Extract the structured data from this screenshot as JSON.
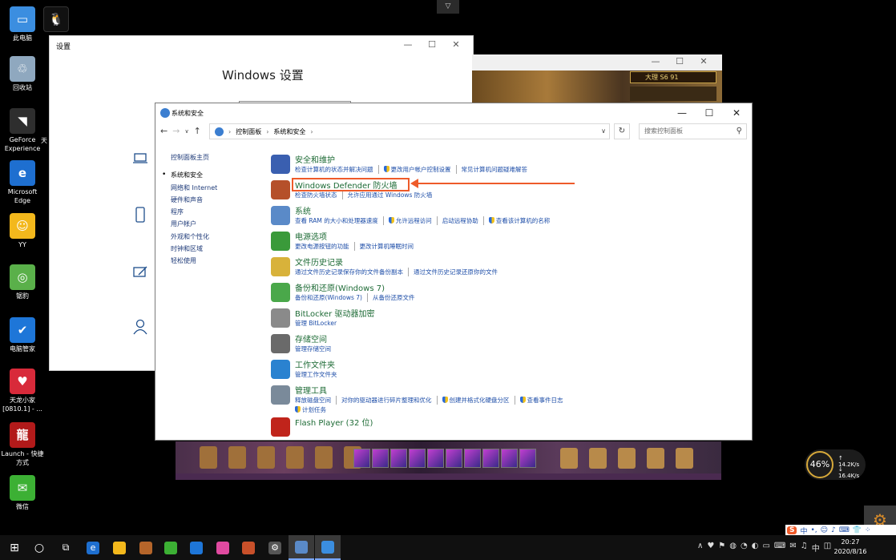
{
  "desktop": {
    "icons": [
      {
        "label": "此电脑",
        "color": "#3b8ee0",
        "glyph": "▭"
      },
      {
        "label": "回收站",
        "color": "#8fa8bf",
        "glyph": "♲"
      },
      {
        "label": "GeForce Experience",
        "color": "#2e2e2e",
        "glyph": "◥"
      },
      {
        "label": "Microsoft Edge",
        "color": "#1e6fd0",
        "glyph": "e"
      },
      {
        "label": "YY",
        "color": "#f3b81c",
        "glyph": "☺"
      },
      {
        "label": "锯豹",
        "color": "#5ab04a",
        "glyph": "◎"
      },
      {
        "label": "电脑管家",
        "color": "#1e76d8",
        "glyph": "✔"
      },
      {
        "label": "天龙小家 [0810.1] - ...",
        "color": "#d82a3a",
        "glyph": "♥"
      },
      {
        "label": "Launch - 快捷方式",
        "color": "#b21a1a",
        "glyph": "龍"
      },
      {
        "label": "微信",
        "color": "#3cb034",
        "glyph": "✉"
      }
    ],
    "partial_labels": [
      "天"
    ]
  },
  "settings_window": {
    "title": "设置",
    "heading": "Windows 设置",
    "controls": [
      "—",
      "☐",
      "✕"
    ]
  },
  "game_window": {
    "badge": "大理    S6  91",
    "controls": [
      "—",
      "☐",
      "✕"
    ]
  },
  "control_panel": {
    "title": "系统和安全",
    "controls": [
      "—",
      "☐",
      "✕"
    ],
    "nav": {
      "back": "←",
      "forward": "→",
      "dropdown": "∨",
      "up": "↑"
    },
    "breadcrumb": [
      "控制面板",
      "系统和安全"
    ],
    "refresh": "↻",
    "search_placeholder": "搜索控制面板",
    "left_nav": {
      "home": "控制面板主页",
      "items": [
        "系统和安全",
        "网络和 Internet",
        "硬件和声音",
        "程序",
        "用户帐户",
        "外观和个性化",
        "时钟和区域",
        "轻松使用"
      ],
      "active_index": 0
    },
    "categories": [
      {
        "title": "安全和维护",
        "icon_color": "#3a5fb0",
        "links": [
          {
            "text": "检查计算机的状态并解决问题"
          },
          {
            "text": "更改用户帐户控制设置",
            "shield": true
          },
          {
            "text": "常见计算机问题疑难解答"
          }
        ]
      },
      {
        "title": "Windows Defender 防火墙",
        "icon_color": "#b5502a",
        "links": [
          {
            "text": "检查防火墙状态"
          },
          {
            "text": "允许应用通过 Windows 防火墙"
          }
        ]
      },
      {
        "title": "系统",
        "icon_color": "#5a8ac8",
        "links": [
          {
            "text": "查看 RAM 的大小和处理器速度"
          },
          {
            "text": "允许远程访问",
            "shield": true
          },
          {
            "text": "启动远程协助"
          },
          {
            "text": "查看该计算机的名称",
            "shield": true
          }
        ]
      },
      {
        "title": "电源选项",
        "icon_color": "#3a9a3a",
        "links": [
          {
            "text": "更改电源按钮的功能"
          },
          {
            "text": "更改计算机睡眠时间"
          }
        ]
      },
      {
        "title": "文件历史记录",
        "icon_color": "#d8b23a",
        "links": [
          {
            "text": "通过文件历史记录保存你的文件备份副本"
          },
          {
            "text": "通过文件历史记录还原你的文件"
          }
        ]
      },
      {
        "title": "备份和还原(Windows 7)",
        "icon_color": "#4aa84a",
        "links": [
          {
            "text": "备份和还原(Windows 7)"
          },
          {
            "text": "从备份还原文件"
          }
        ]
      },
      {
        "title": "BitLocker 驱动器加密",
        "icon_color": "#8a8a8a",
        "links": [
          {
            "text": "管理 BitLocker"
          }
        ]
      },
      {
        "title": "存储空间",
        "icon_color": "#6a6a6a",
        "links": [
          {
            "text": "管理存储空间"
          }
        ]
      },
      {
        "title": "工作文件夹",
        "icon_color": "#2a82d0",
        "links": [
          {
            "text": "管理工作文件夹"
          }
        ]
      },
      {
        "title": "管理工具",
        "icon_color": "#7a8a9a",
        "links": [
          {
            "text": "释放磁盘空间"
          },
          {
            "text": "对你的驱动器进行碎片整理和优化"
          },
          {
            "text": "创建并格式化硬盘分区",
            "shield": true
          },
          {
            "text": "查看事件日志",
            "shield": true
          }
        ],
        "links2": [
          {
            "text": "计划任务",
            "shield": true
          }
        ]
      },
      {
        "title": "Flash Player (32 位)",
        "icon_color": "#c0241b",
        "links": []
      }
    ],
    "highlight": {
      "target": "Windows Defender 防火墙",
      "color": "#ee5b2a"
    }
  },
  "net_widget": {
    "percent": "46%",
    "up": "14.2K/s",
    "down": "16.4K/s"
  },
  "ime_bar": {
    "logo": "S",
    "items": [
      "中",
      "•,",
      "☺",
      "♪",
      "⌨",
      "👕",
      "⁘"
    ]
  },
  "taskbar": {
    "start": "⊞",
    "search": "○",
    "taskview": "⧉",
    "apps": [
      {
        "name": "edge",
        "color": "#1e6fd0",
        "glyph": "e"
      },
      {
        "name": "yy",
        "color": "#f3b81c",
        "glyph": ""
      },
      {
        "name": "game-launcher",
        "color": "#b5652a",
        "glyph": ""
      },
      {
        "name": "wechat",
        "color": "#3cb034",
        "glyph": ""
      },
      {
        "name": "pc-manager",
        "color": "#1e76d8",
        "glyph": ""
      },
      {
        "name": "photos",
        "color": "#e04aa0",
        "glyph": ""
      },
      {
        "name": "game-app",
        "color": "#c8502a",
        "glyph": ""
      },
      {
        "name": "settings",
        "color": "#555555",
        "glyph": "⚙"
      },
      {
        "name": "control-panel",
        "color": "#5a8ac8",
        "glyph": ""
      },
      {
        "name": "window-app",
        "color": "#3b8ee0",
        "glyph": ""
      }
    ],
    "tray_icons": [
      "∧",
      "♥",
      "⚑",
      "◍",
      "◔",
      "◐",
      "▭",
      "⌨",
      "✉",
      "♫",
      "中",
      "◫"
    ],
    "time": "20:27",
    "date": "2020/8/16"
  }
}
